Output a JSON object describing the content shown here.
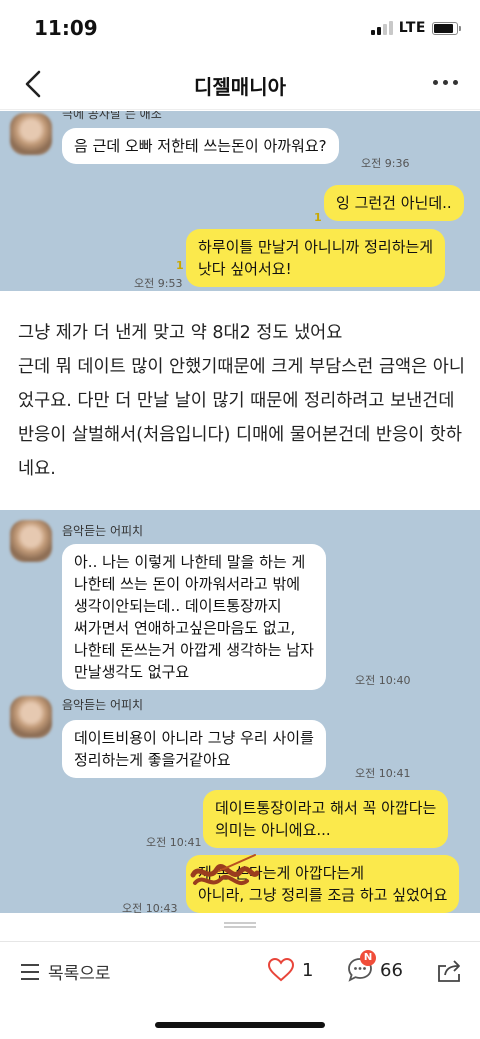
{
  "status_bar": {
    "time": "11:09",
    "network": "LTE",
    "battery_level": 0.85
  },
  "nav": {
    "title": "디젤매니아"
  },
  "chat1": {
    "cut_sender": "극에 공사달 는 애조",
    "msg1": "음 근데 오빠 저한테 쓰는돈이 아까워요?",
    "msg1_time": "오전 9:36",
    "reply1_unread": "1",
    "reply1": "잉 그런건 아닌데..",
    "reply2_unread": "1",
    "reply2": "하루이틀 만날거 아니니까 정리하는게\n낫다 싶어서요!",
    "reply2_time": "오전 9:53"
  },
  "post": {
    "body": "그냥 제가 더 낸게 맞고 약 8대2 정도 냈어요\n근데 뭐 데이트 많이 안했기때문에 크게 부담스런 금액은 아니었구요. 다만 더 만날 날이 많기 때문에 정리하려고 보낸건데 반응이 살벌해서(처음입니다) 디매에 물어본건데 반응이 핫하네요."
  },
  "chat2": {
    "sender1": "음악듣는 어피치",
    "msg1": "아.. 나는 이렇게 나한테 말을 하는 게\n나한테 쓰는 돈이 아까워서라고 밖에\n생각이안되는데.. 데이트통장까지\n써가면서 연애하고싶은마음도 없고,\n나한테 돈쓰는거 아깝게 생각하는 남자\n만날생각도 없구요",
    "msg1_time": "오전 10:40",
    "sender2": "음악듣는 어피치",
    "msg2": "데이트비용이 아니라 그냥 우리 사이를\n정리하는게 좋을거같아요",
    "msg2_time": "오전 10:41",
    "reply1": "데이트통장이라고 해서 꼭 아깝다는\n의미는 아니에요...",
    "reply1_time": "오전 10:41",
    "reply2": "제 돈 쓴다는게 아깝다는게\n아니라, 그냥 정리를 조금 하고 싶었어요",
    "reply2_time": "오전 10:43"
  },
  "bottom": {
    "list_label": "목록으로",
    "likes": "1",
    "comments": "66",
    "new_badge": "N"
  }
}
